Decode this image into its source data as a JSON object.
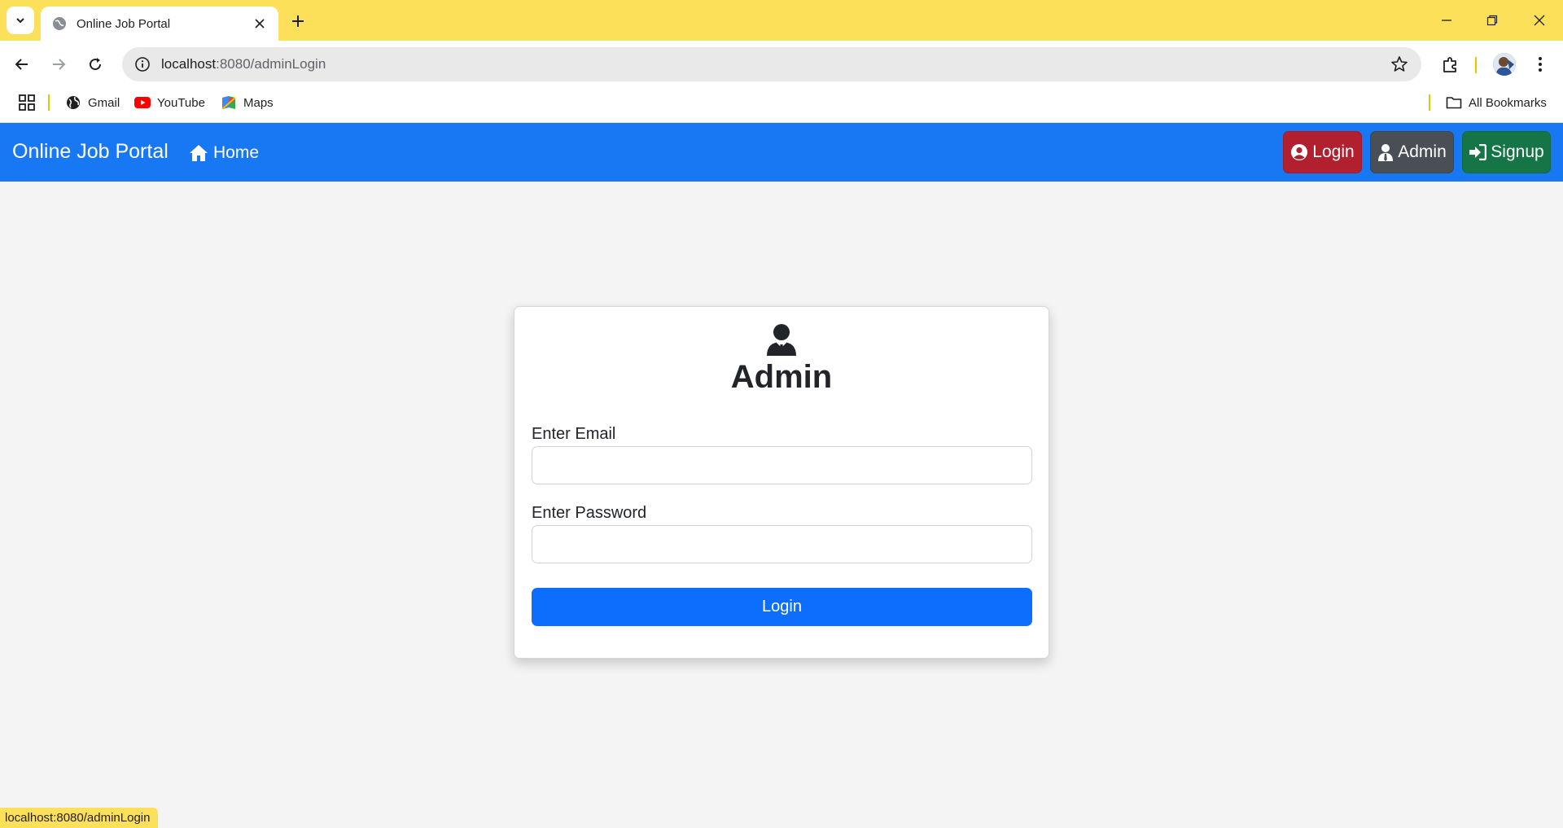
{
  "browser": {
    "tab_title": "Online Job Portal",
    "url_host": "localhost",
    "url_path": ":8080/adminLogin",
    "bookmarks": [
      {
        "label": "Gmail",
        "icon": "globe-icon"
      },
      {
        "label": "YouTube",
        "icon": "youtube-icon"
      },
      {
        "label": "Maps",
        "icon": "maps-icon"
      }
    ],
    "all_bookmarks_label": "All Bookmarks",
    "status_url": "localhost:8080/adminLogin",
    "accent_color": "#fde05a"
  },
  "navbar": {
    "brand": "Online Job Portal",
    "home_label": "Home",
    "login_label": "Login",
    "admin_label": "Admin",
    "signup_label": "Signup",
    "bg_color": "#1877f2"
  },
  "form": {
    "title": "Admin",
    "email_label": "Enter Email",
    "email_value": "",
    "password_label": "Enter Password",
    "password_value": "",
    "submit_label": "Login",
    "submit_color": "#0d6efd"
  }
}
